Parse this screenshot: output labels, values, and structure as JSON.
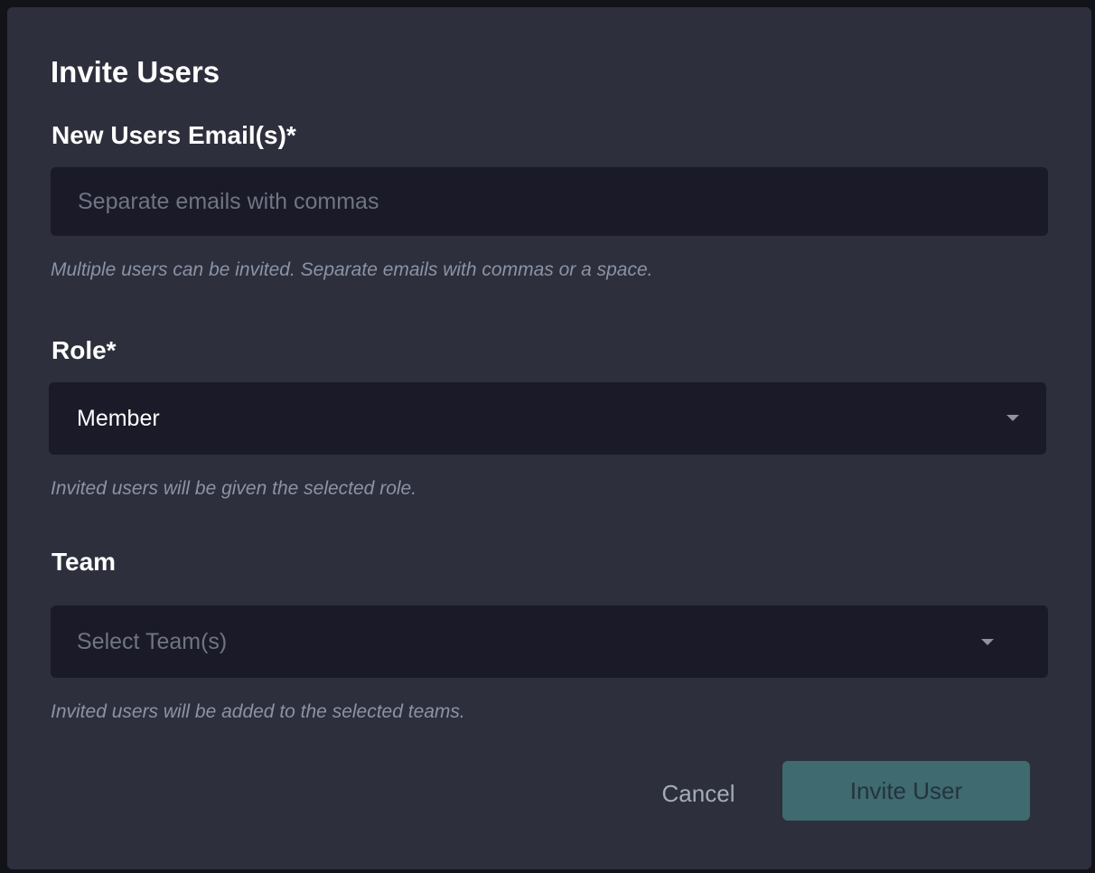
{
  "dialog": {
    "title": "Invite Users",
    "email": {
      "label": "New Users Email(s)*",
      "placeholder": "Separate emails with commas",
      "help": "Multiple users can be invited. Separate emails with commas or a space."
    },
    "role": {
      "label": "Role*",
      "selected": "Member",
      "help": "Invited users will be given the selected role."
    },
    "team": {
      "label": "Team",
      "placeholder": "Select Team(s)",
      "help": "Invited users will be added to the selected teams."
    },
    "buttons": {
      "cancel": "Cancel",
      "invite": "Invite User"
    }
  },
  "colors": {
    "backdrop": "#121319",
    "dialog_bg": "#2d2f3c",
    "field_bg": "#1a1a28",
    "primary_button": "#3e6a70",
    "help_text": "#8b93a6"
  },
  "icons": {
    "role_dropdown": "caret-down-icon",
    "team_dropdown": "caret-down-icon"
  }
}
